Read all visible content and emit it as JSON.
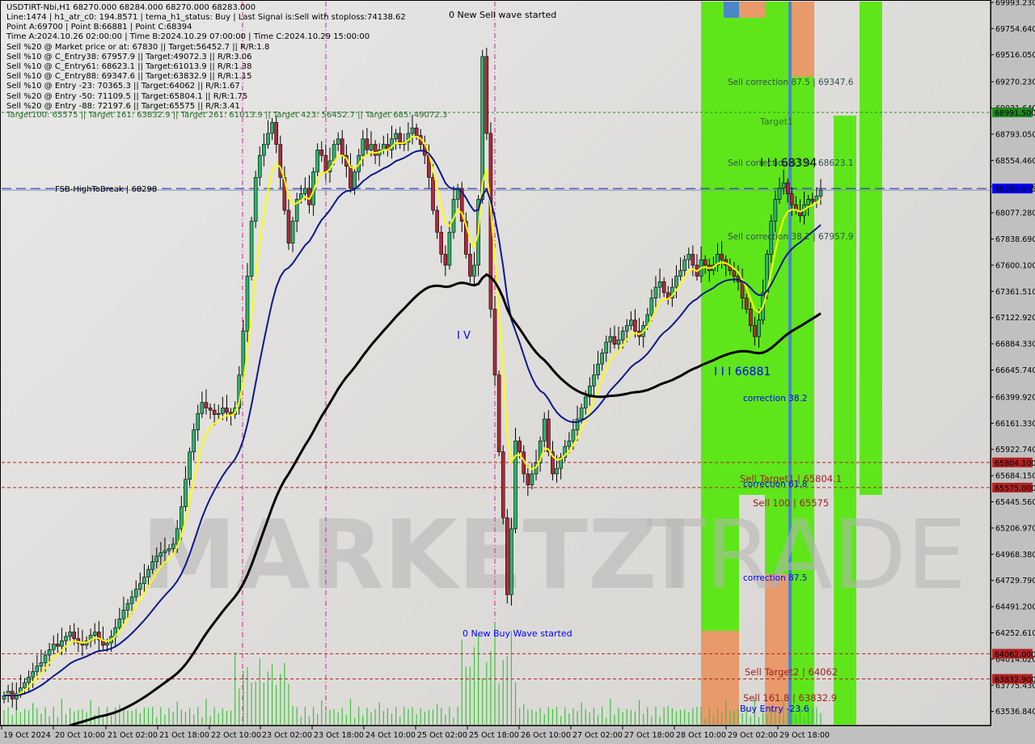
{
  "window": {
    "symbol_line": "USDTIRT-Nbi,H1  68270.000 68284.000 68270.000 68283.000"
  },
  "info_lines": [
    "Line:1474 | h1_atr_c0: 194.8571 | tema_h1_status: Buy | Last Signal is:Sell with stoploss:74138.62",
    "Point A:69700 | Point B:66881 | Point C:68394",
    "Time A:2024.10.26 02:00:00 | Time B:2024.10.29 07:00:00 | Time C:2024.10.29 15:00:00",
    "Sell %20 @ Market price or at: 67830 || Target:56452.7 || R/R:1.8",
    "Sell %10 @ C_Entry38: 67957.9 || Target:49072.3 || R/R:3.06",
    "Sell %10 @ C_Entry61: 68623.1 || Target:61013.9 || R/R:1.38",
    "Sell %10 @ C_Entry88: 69347.6 || Target:63832.9 || R/R:1.15",
    "Sell %10 @ Entry -23: 70365.3 || Target:64062 || R/R:1.67",
    "Sell %20 @ Entry -50: 71109.5 || Target:65804.1 || R/R:1.75",
    "Sell %20 @ Entry -88: 72197.6 || Target:65575 || R/R:3.41"
  ],
  "targets_line": "Target100: 65575 || Target 161: 63832.9 || Target 261: 61013.9 || Target 423: 56452.7 || Target 685: 49072.3",
  "watermark": {
    "left": "MARKETZI",
    "right": "TRADE"
  },
  "colors": {
    "bull": "#2db36a",
    "bear": "#b3283a",
    "ma_yellow": "#ffff00",
    "ma_navy": "#0a1a8a",
    "ma_black": "#000000",
    "zone_green": "#5ee61a",
    "zone_orange": "#e89a6a",
    "zone_blue": "#4a88c8",
    "level_red": "#b22222",
    "level_green": "#1e8a1e",
    "level_blue": "#1020c0",
    "volume": "#3cc43c"
  },
  "chart_data": {
    "type": "candlestick",
    "title": "USDTIRT-Nbi,H1",
    "ylim": [
      63417,
      70000
    ],
    "y_ticks": [
      69993.23,
      69754.64,
      69516.05,
      69270.23,
      69031.64,
      68793.05,
      68554.46,
      68316.0,
      68077.28,
      67838.69,
      67600.1,
      67361.51,
      67122.92,
      66884.33,
      66645.74,
      66399.92,
      66161.33,
      65922.74,
      65684.15,
      65445.56,
      65206.97,
      64968.38,
      64729.79,
      64491.2,
      64252.61,
      64014.02,
      63775.43,
      63536.84
    ],
    "x_ticks": [
      "19 Oct 2024",
      "20 Oct 10:00",
      "21 Oct 02:00",
      "21 Oct 18:00",
      "22 Oct 10:00",
      "23 Oct 02:00",
      "23 Oct 18:00",
      "24 Oct 10:00",
      "25 Oct 02:00",
      "25 Oct 18:00",
      "26 Oct 10:00",
      "27 Oct 02:00",
      "27 Oct 18:00",
      "28 Oct 10:00",
      "29 Oct 02:00",
      "29 Oct 18:00"
    ],
    "price_tags": [
      {
        "value": 68991.5,
        "label": "68991.500",
        "color": "#1e8a1e"
      },
      {
        "value": 68298.0,
        "label": "68298.000",
        "color": "#0000ff"
      },
      {
        "value": 65804.1,
        "label": "65804.100",
        "color": "#b22222"
      },
      {
        "value": 65575.0,
        "label": "65575.000",
        "color": "#b22222"
      },
      {
        "value": 64062.0,
        "label": "64062.000",
        "color": "#b22222"
      },
      {
        "value": 63832.9,
        "label": "63832.900",
        "color": "#b22222"
      }
    ],
    "levels": [
      {
        "value": 68991.5,
        "style": "green-dashed",
        "label": "Target1"
      },
      {
        "value": 68298.0,
        "style": "blue-dashed",
        "label": "FSB-HighToBreak | 68298"
      },
      {
        "value": 65804.1,
        "style": "red-dashed",
        "label": "Sell Target1 | 65804.1"
      },
      {
        "value": 65575.0,
        "style": "red-dashed",
        "label": "Sell 100 | 65575"
      },
      {
        "value": 64062.0,
        "style": "red-dashed",
        "label": "Sell Target2 | 64062"
      },
      {
        "value": 63832.9,
        "style": "red-dashed",
        "label": "Sell 161.8 | 63832.9"
      }
    ],
    "annotations": [
      {
        "text": "0 New Sell wave started",
        "color": "#000000"
      },
      {
        "text": "0 New Buy Wave started",
        "color": "#0000ff"
      },
      {
        "text": "I V",
        "color": "#0000ff"
      },
      {
        "text": "I I I 66881",
        "color": "#0000ff"
      },
      {
        "text": "I I I 68394",
        "color": "#000000"
      },
      {
        "text": "Sell correction 87.5 | 69347.6",
        "color": "#2f4f4f"
      },
      {
        "text": "Sell correction 61.8 | 68623.1",
        "color": "#2f4f4f"
      },
      {
        "text": "Sell correction 38.2 | 67957.9",
        "color": "#2f4f4f"
      },
      {
        "text": "correction 38.2",
        "color": "#0000ff"
      },
      {
        "text": "correction 61.8",
        "color": "#0000ff"
      },
      {
        "text": "correction 87.5",
        "color": "#0000ff"
      },
      {
        "text": "Buy Entry -23.6",
        "color": "#0000ff"
      }
    ],
    "series": [
      {
        "name": "close",
        "values": [
          63680,
          63720,
          63650,
          63700,
          63750,
          63800,
          63850,
          63900,
          63950,
          63980,
          64050,
          64100,
          64150,
          64130,
          64180,
          64220,
          64260,
          64200,
          64160,
          64140,
          64180,
          64230,
          64260,
          64190,
          64140,
          64160,
          64220,
          64300,
          64380,
          64460,
          64520,
          64580,
          64650,
          64700,
          64760,
          64830,
          64900,
          64950,
          64980,
          65000,
          65020,
          65060,
          65200,
          65400,
          65650,
          65900,
          66100,
          66250,
          66350,
          66300,
          66280,
          66240,
          66250,
          66300,
          66260,
          66240,
          66300,
          66600,
          67000,
          67500,
          68000,
          68400,
          68600,
          68700,
          68800,
          68900,
          68700,
          68400,
          68100,
          67800,
          68000,
          68200,
          68250,
          68300,
          68150,
          68450,
          68650,
          68600,
          68450,
          68550,
          68700,
          68750,
          68600,
          68500,
          68300,
          68450,
          68600,
          68750,
          68650,
          68700,
          68600,
          68650,
          68700,
          68650,
          68750,
          68800,
          68700,
          68720,
          68800,
          68850,
          68780,
          68700,
          68600,
          68400,
          68100,
          67900,
          67700,
          67600,
          67900,
          68200,
          68300,
          68000,
          67700,
          67500,
          67600,
          68200,
          69500,
          68800,
          67200,
          66600,
          65900,
          65300,
          64600,
          65200,
          66000,
          65900,
          65700,
          65600,
          65700,
          65800,
          66000,
          66200,
          65900,
          65700,
          65750,
          65850,
          65950,
          66000,
          66100,
          66200,
          66300,
          66400,
          66500,
          66600,
          66700,
          66800,
          66900,
          66950,
          66880,
          66920,
          67000,
          67050,
          67100,
          67000,
          66950,
          67050,
          67150,
          67300,
          67400,
          67450,
          67350,
          67300,
          67400,
          67500,
          67550,
          67650,
          67700,
          67600,
          67500,
          67650,
          67600,
          67550,
          67600,
          67700,
          67650,
          67600,
          67550,
          67500,
          67450,
          67300,
          67200,
          67050,
          66950,
          67100,
          67350,
          67700,
          68000,
          68200,
          68300,
          68350,
          68250,
          68150,
          68100,
          68050,
          68150,
          68200,
          68180,
          68230,
          68283
        ]
      },
      {
        "name": "EMA (yellow)",
        "values": []
      },
      {
        "name": "MA (navy)",
        "values": []
      },
      {
        "name": "MA (black)",
        "values": []
      },
      {
        "name": "volume",
        "values": []
      }
    ]
  }
}
